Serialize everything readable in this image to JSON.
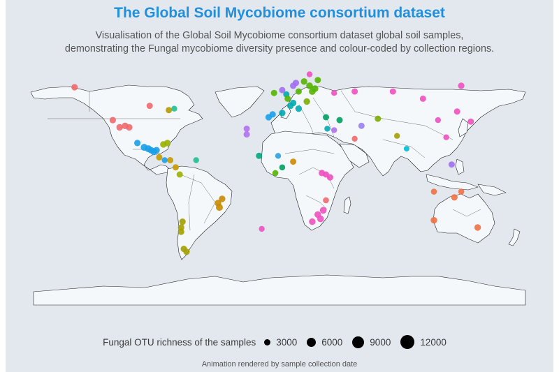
{
  "title": "The Global Soil Mycobiome consortium dataset",
  "subtitle_line1": "Visualisation of the Global Soil Mycobiome consortium dataset global soil samples,",
  "subtitle_line2": "demonstrating the Fungal mycobiome diversity presence and colour-coded by collection regions.",
  "legend": {
    "title": "Fungal OTU richness of the samples",
    "keys": [
      {
        "label": "3000",
        "value": 3000
      },
      {
        "label": "6000",
        "value": 6000
      },
      {
        "label": "9000",
        "value": 9000
      },
      {
        "label": "12000",
        "value": 12000
      }
    ]
  },
  "caption": "Animation rendered by sample collection date",
  "colors": {
    "background": "#e3e8ee",
    "land": "#f5f8fb",
    "border": "#222222",
    "title": "#1f8fde"
  },
  "samples": [
    {
      "lon": -150,
      "lat": 61,
      "color": "#f0686b",
      "size": 4500
    },
    {
      "lon": -122,
      "lat": 38,
      "color": "#f0686b",
      "size": 4500
    },
    {
      "lon": -117,
      "lat": 33,
      "color": "#f0686b",
      "size": 5000
    },
    {
      "lon": -113,
      "lat": 34,
      "color": "#f0686b",
      "size": 5000
    },
    {
      "lon": -110,
      "lat": 33,
      "color": "#f0686b",
      "size": 5000
    },
    {
      "lon": -95,
      "lat": 48,
      "color": "#f0686b",
      "size": 4000
    },
    {
      "lon": -81,
      "lat": 45,
      "color": "#b59a00",
      "size": 4000
    },
    {
      "lon": -77,
      "lat": 46,
      "color": "#1fbf8f",
      "size": 3000
    },
    {
      "lon": -104,
      "lat": 22,
      "color": "#1a9fe8",
      "size": 4500
    },
    {
      "lon": -99,
      "lat": 19,
      "color": "#1a9fe8",
      "size": 6000
    },
    {
      "lon": -96,
      "lat": 18,
      "color": "#1a9fe8",
      "size": 6000
    },
    {
      "lon": -94,
      "lat": 17,
      "color": "#1a9fe8",
      "size": 5000
    },
    {
      "lon": -92,
      "lat": 16,
      "color": "#1a9fe8",
      "size": 6000
    },
    {
      "lon": -90,
      "lat": 17,
      "color": "#1a9fe8",
      "size": 5000
    },
    {
      "lon": -85,
      "lat": 21,
      "color": "#9ab000",
      "size": 5000
    },
    {
      "lon": -82,
      "lat": 22,
      "color": "#9ab000",
      "size": 5000
    },
    {
      "lon": -80,
      "lat": 10,
      "color": "#c49a00",
      "size": 4000
    },
    {
      "lon": -88,
      "lat": 12,
      "color": "#c49a00",
      "size": 4000
    },
    {
      "lon": -76,
      "lat": 5,
      "color": "#c49a00",
      "size": 4000
    },
    {
      "lon": -61,
      "lat": 10,
      "color": "#1fbf8f",
      "size": 3000
    },
    {
      "lon": -73,
      "lat": 0,
      "color": "#9ab000",
      "size": 4000
    },
    {
      "lon": -84,
      "lat": 10,
      "color": "#1a9fe8",
      "size": 3000
    },
    {
      "lon": -45,
      "lat": -20,
      "color": "#c98a00",
      "size": 5000
    },
    {
      "lon": -42,
      "lat": -17,
      "color": "#c98a00",
      "size": 5000
    },
    {
      "lon": -44,
      "lat": -23,
      "color": "#c98a00",
      "size": 6000
    },
    {
      "lon": -71,
      "lat": -33,
      "color": "#a4a000",
      "size": 4500
    },
    {
      "lon": -72,
      "lat": -37,
      "color": "#a4a000",
      "size": 4500
    },
    {
      "lon": -72,
      "lat": -40,
      "color": "#a4a000",
      "size": 4500
    },
    {
      "lon": -70,
      "lat": -52,
      "color": "#a4a000",
      "size": 4500
    },
    {
      "lon": -68,
      "lat": -54,
      "color": "#a4a000",
      "size": 4500
    },
    {
      "lon": -13,
      "lat": -38,
      "color": "#f050c0",
      "size": 3000
    },
    {
      "lon": -24,
      "lat": 28,
      "color": "#b070f0",
      "size": 4000
    },
    {
      "lon": -24,
      "lat": 32,
      "color": "#b070f0",
      "size": 4000
    },
    {
      "lon": -8,
      "lat": 40,
      "color": "#1a9fe8",
      "size": 4500
    },
    {
      "lon": -5,
      "lat": 42,
      "color": "#1a9fe8",
      "size": 4500
    },
    {
      "lon": 2,
      "lat": 43,
      "color": "#00aab0",
      "size": 5000
    },
    {
      "lon": 8,
      "lat": 48,
      "color": "#00aab0",
      "size": 5000
    },
    {
      "lon": 14,
      "lat": 46,
      "color": "#00aab0",
      "size": 5000
    },
    {
      "lon": 10,
      "lat": 50,
      "color": "#00aab0",
      "size": 4500
    },
    {
      "lon": 5,
      "lat": 56,
      "color": "#00aab0",
      "size": 4000
    },
    {
      "lon": 20,
      "lat": 51,
      "color": "#7cae00",
      "size": 5000
    },
    {
      "lon": 24,
      "lat": 58,
      "color": "#53b400",
      "size": 5500
    },
    {
      "lon": 26,
      "lat": 60,
      "color": "#53b400",
      "size": 5500
    },
    {
      "lon": 22,
      "lat": 62,
      "color": "#53b400",
      "size": 5500
    },
    {
      "lon": 18,
      "lat": 65,
      "color": "#53b400",
      "size": 5000
    },
    {
      "lon": 12,
      "lat": 64,
      "color": "#a070f0",
      "size": 4500
    },
    {
      "lon": 10,
      "lat": 62,
      "color": "#a070f0",
      "size": 4500
    },
    {
      "lon": 2,
      "lat": 59,
      "color": "#a070f0",
      "size": 4000
    },
    {
      "lon": -4,
      "lat": 57,
      "color": "#53b400",
      "size": 4000
    },
    {
      "lon": 14,
      "lat": 58,
      "color": "#53b400",
      "size": 4000
    },
    {
      "lon": 6,
      "lat": 53,
      "color": "#53b400",
      "size": 4000
    },
    {
      "lon": 22,
      "lat": 70,
      "color": "#f050c0",
      "size": 3000
    },
    {
      "lon": 28,
      "lat": 66,
      "color": "#53b400",
      "size": 4000
    },
    {
      "lon": 40,
      "lat": 57,
      "color": "#f050c0",
      "size": 3000
    },
    {
      "lon": 55,
      "lat": 58,
      "color": "#f050c0",
      "size": 4000
    },
    {
      "lon": 83,
      "lat": 58,
      "color": "#f050c0",
      "size": 4000
    },
    {
      "lon": 105,
      "lat": 53,
      "color": "#f050c0",
      "size": 4000
    },
    {
      "lon": 133,
      "lat": 62,
      "color": "#f050c0",
      "size": 4500
    },
    {
      "lon": 130,
      "lat": 44,
      "color": "#f050c0",
      "size": 4000
    },
    {
      "lon": 140,
      "lat": 37,
      "color": "#f050c0",
      "size": 4000
    },
    {
      "lon": 34,
      "lat": 40,
      "color": "#009e60",
      "size": 4000
    },
    {
      "lon": 44,
      "lat": 38,
      "color": "#009e60",
      "size": 4000
    },
    {
      "lon": 40,
      "lat": 31,
      "color": "#b070f0",
      "size": 3000
    },
    {
      "lon": 60,
      "lat": 34,
      "color": "#9a80f0",
      "size": 4000
    },
    {
      "lon": 72,
      "lat": 39,
      "color": "#7cae00",
      "size": 4000
    },
    {
      "lon": 86,
      "lat": 27,
      "color": "#a4a000",
      "size": 3000
    },
    {
      "lon": 35,
      "lat": 32,
      "color": "#00aab0",
      "size": 3000
    },
    {
      "lon": 55,
      "lat": 25,
      "color": "#f0686b",
      "size": 3000
    },
    {
      "lon": 93,
      "lat": 18,
      "color": "#00bcd0",
      "size": 2500
    },
    {
      "lon": 116,
      "lat": 38,
      "color": "#f050c0",
      "size": 3000
    },
    {
      "lon": 122,
      "lat": 26,
      "color": "#f050c0",
      "size": 3000
    },
    {
      "lon": -1,
      "lat": 13,
      "color": "#2aa0e0",
      "size": 3000
    },
    {
      "lon": -15,
      "lat": 13,
      "color": "#00aa80",
      "size": 4000
    },
    {
      "lon": 10,
      "lat": 9,
      "color": "#d08800",
      "size": 4000
    },
    {
      "lon": 2,
      "lat": 5,
      "color": "#009e60",
      "size": 3500
    },
    {
      "lon": -3,
      "lat": 1,
      "color": "#53b400",
      "size": 3500
    },
    {
      "lon": 37,
      "lat": -2,
      "color": "#f050c0",
      "size": 4500
    },
    {
      "lon": 31,
      "lat": 1,
      "color": "#f050c0",
      "size": 4500
    },
    {
      "lon": 34,
      "lat": 0,
      "color": "#f050c0",
      "size": 4000
    },
    {
      "lon": 32,
      "lat": -25,
      "color": "#f050c0",
      "size": 5500
    },
    {
      "lon": 28,
      "lat": -28,
      "color": "#f050c0",
      "size": 5500
    },
    {
      "lon": 30,
      "lat": -31,
      "color": "#f050c0",
      "size": 5500
    },
    {
      "lon": 24,
      "lat": -33,
      "color": "#f050c0",
      "size": 5000
    },
    {
      "lon": 34,
      "lat": -18,
      "color": "#f0686b",
      "size": 3500
    },
    {
      "lon": 126,
      "lat": 7,
      "color": "#a070f0",
      "size": 4000
    },
    {
      "lon": 113,
      "lat": -12,
      "color": "#f07040",
      "size": 3500
    },
    {
      "lon": 128,
      "lat": -16,
      "color": "#f07040",
      "size": 4500
    },
    {
      "lon": 113,
      "lat": -32,
      "color": "#f07040",
      "size": 5000
    },
    {
      "lon": 145,
      "lat": -37,
      "color": "#f07040",
      "size": 5000
    },
    {
      "lon": 133,
      "lat": -12,
      "color": "#f07040",
      "size": 3500
    }
  ]
}
